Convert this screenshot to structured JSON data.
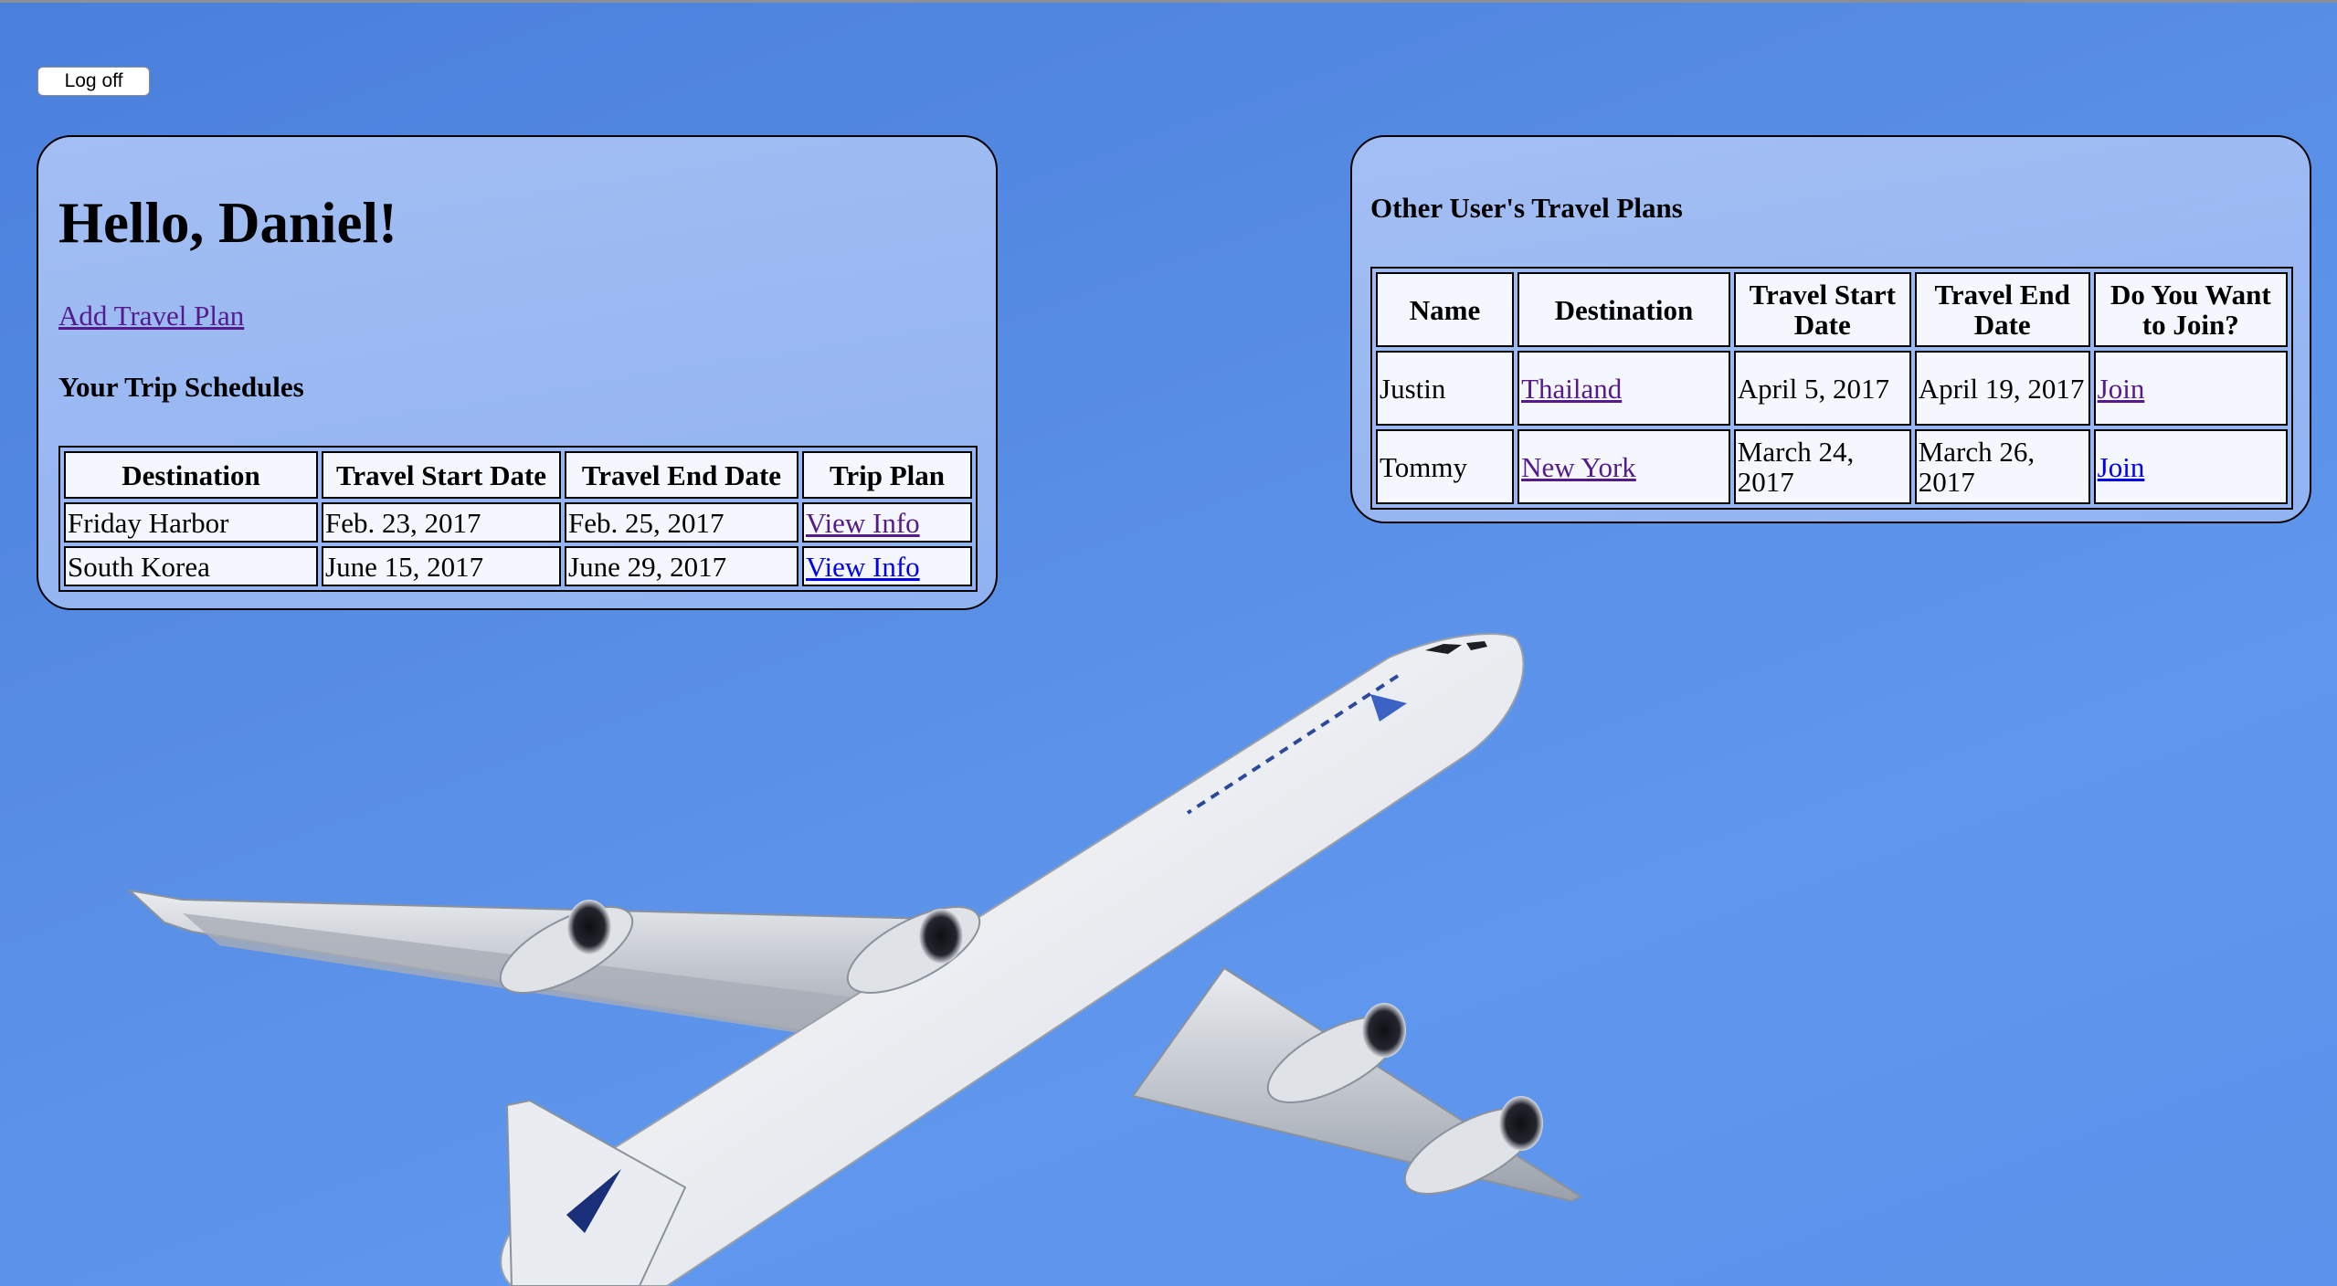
{
  "header": {
    "logoff_label": "Log off"
  },
  "left_panel": {
    "greeting": "Hello, Daniel!",
    "add_plan_link": "Add Travel Plan",
    "section_title": "Your Trip Schedules",
    "columns": [
      "Destination",
      "Travel Start Date",
      "Travel End Date",
      "Trip Plan"
    ],
    "rows": [
      {
        "destination": "Friday Harbor",
        "start": "Feb. 23, 2017",
        "end": "Feb. 25, 2017",
        "link": "View Info"
      },
      {
        "destination": "South Korea",
        "start": "June 15, 2017",
        "end": "June 29, 2017",
        "link": "View Info"
      }
    ]
  },
  "right_panel": {
    "section_title": "Other User's Travel Plans",
    "columns": [
      "Name",
      "Destination",
      "Travel Start Date",
      "Travel End Date",
      "Do You Want to Join?"
    ],
    "rows": [
      {
        "name": "Justin",
        "destination": "Thailand",
        "start": "April 5, 2017",
        "end": "April 19, 2017",
        "join": "Join"
      },
      {
        "name": "Tommy",
        "destination": "New York",
        "start": "March 24, 2017",
        "end": "March 26, 2017",
        "join": "Join"
      }
    ]
  },
  "colors": {
    "sky": "#5b93ec",
    "panel": "#9db9f2",
    "link_visited": "#551a8b",
    "link_unvisited": "#0000ee"
  },
  "background_image": {
    "subject": "airplane-in-blue-sky"
  }
}
